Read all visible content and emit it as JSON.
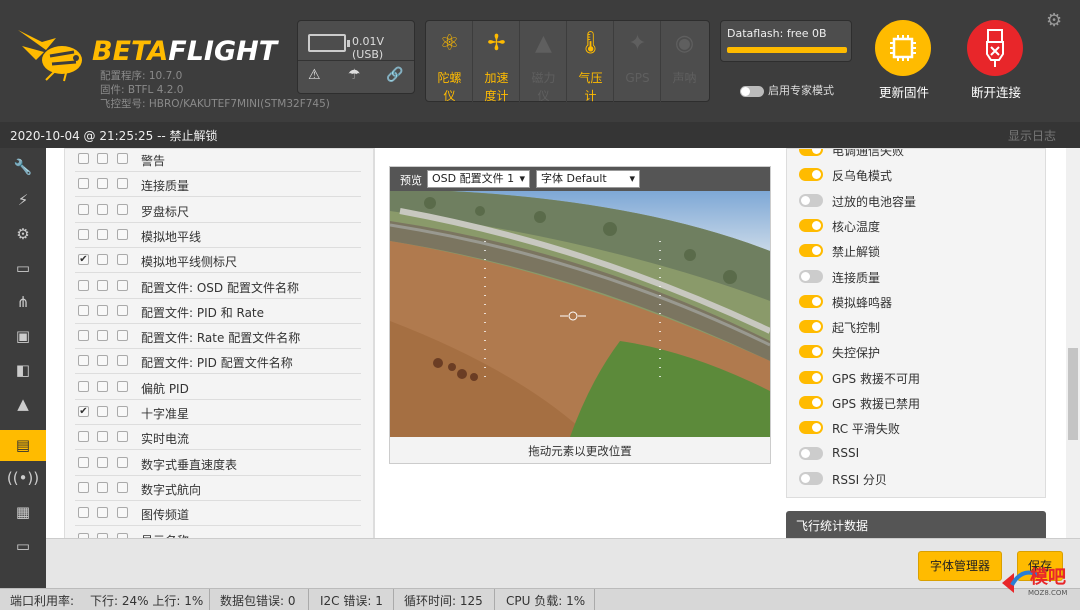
{
  "app": {
    "name_beta": "BETA",
    "name_flight": "FLIGHT",
    "configurator": "配置程序: 10.7.0",
    "firmware": "固件: BTFL 4.2.0",
    "board": "飞控型号: HBRO/KAKUTEF7MINI(STM32F745)"
  },
  "battery": {
    "voltage": "0.01V (USB)"
  },
  "sensors": [
    {
      "label": "陀螺\n仪",
      "icon": "gyro-icon",
      "state": "on"
    },
    {
      "label": "加速\n度计",
      "icon": "accelerometer-icon",
      "state": "on"
    },
    {
      "label": "磁力\n仪",
      "icon": "compass-icon",
      "state": "off"
    },
    {
      "label": "气压\n计",
      "icon": "barometer-icon",
      "state": "on"
    },
    {
      "label": "GPS",
      "icon": "gps-icon",
      "state": "off"
    },
    {
      "label": "声呐",
      "icon": "sonar-icon",
      "state": "off"
    }
  ],
  "dataflash": {
    "label": "Dataflash: free 0B"
  },
  "expert_mode": "启用专家模式",
  "buttons": {
    "update_firmware": "更新固件",
    "disconnect": "断开连接",
    "font_manager": "字体管理器",
    "save": "保存"
  },
  "status": {
    "datetime": "2020-10-04 @ 21:25:25 -- 禁止解锁",
    "show_log": "显示日志"
  },
  "elements": [
    {
      "label": "警告",
      "checked": false
    },
    {
      "label": "连接质量",
      "checked": false
    },
    {
      "label": "罗盘标尺",
      "checked": false
    },
    {
      "label": "模拟地平线",
      "checked": false
    },
    {
      "label": "模拟地平线侧标尺",
      "checked": true
    },
    {
      "label": "配置文件: OSD 配置文件名称",
      "checked": false
    },
    {
      "label": "配置文件: PID 和 Rate",
      "checked": false
    },
    {
      "label": "配置文件: Rate 配置文件名称",
      "checked": false
    },
    {
      "label": "配置文件:  PID 配置文件名称",
      "checked": false
    },
    {
      "label": "偏航 PID",
      "checked": false
    },
    {
      "label": "十字准星",
      "checked": true
    },
    {
      "label": "实时电流",
      "checked": false
    },
    {
      "label": "数字式垂直速度表",
      "checked": false
    },
    {
      "label": "数字式航向",
      "checked": false
    },
    {
      "label": "图传频道",
      "checked": false
    },
    {
      "label": "显示名称",
      "checked": false
    }
  ],
  "preview": {
    "label": "预览",
    "profile_select": "OSD 配置文件 1",
    "font_select": "字体 Default",
    "hint": "拖动元素以更改位置"
  },
  "switches": [
    {
      "label": "电调通信失败",
      "on": true
    },
    {
      "label": "反乌龟模式",
      "on": true
    },
    {
      "label": "过放的电池容量",
      "on": false
    },
    {
      "label": "核心温度",
      "on": true
    },
    {
      "label": "禁止解锁",
      "on": true
    },
    {
      "label": "连接质量",
      "on": false
    },
    {
      "label": "模拟蜂鸣器",
      "on": true
    },
    {
      "label": "起飞控制",
      "on": true
    },
    {
      "label": "失控保护",
      "on": true
    },
    {
      "label": "GPS 救援不可用",
      "on": true
    },
    {
      "label": "GPS 救援已禁用",
      "on": true
    },
    {
      "label": "RC 平滑失败",
      "on": true
    },
    {
      "label": "RSSI",
      "on": false
    },
    {
      "label": "RSSI 分贝",
      "on": false
    }
  ],
  "stats_title": "飞行统计数据",
  "footer": {
    "port_usage": "端口利用率:",
    "down_up": "下行: 24% 上行: 1%",
    "packet_errors": "数据包错误: 0",
    "i2c_errors": "I2C 错误: 1",
    "cycle_time": "循环时间: 125",
    "cpu_load": "CPU 负载: 1%"
  },
  "watermark": {
    "text": "模吧",
    "sub": "MOZ8.COM"
  },
  "colors": {
    "accent": "#ffbb00",
    "disconnect": "#e8262a",
    "header_bg": "#3d3d3d"
  }
}
